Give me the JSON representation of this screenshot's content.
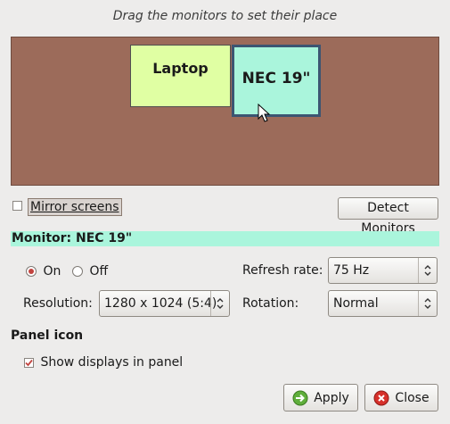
{
  "hint": "Drag the monitors to set their place",
  "monitors": [
    {
      "name": "Laptop"
    },
    {
      "name": "NEC 19\""
    }
  ],
  "mirror": {
    "label": "Mirror screens",
    "checked": false
  },
  "detect_button": "Detect Monitors",
  "monitor_bar": "Monitor: NEC 19\"",
  "power": {
    "on_label": "On",
    "off_label": "Off",
    "selected": "On"
  },
  "resolution": {
    "label": "Resolution:",
    "value": "1280 x 1024 (5:4)"
  },
  "refresh": {
    "label": "Refresh rate:",
    "value": "75 Hz"
  },
  "rotation": {
    "label": "Rotation:",
    "value": "Normal"
  },
  "panel": {
    "heading": "Panel icon",
    "show_label": "Show displays in panel",
    "show_checked": true
  },
  "buttons": {
    "apply": "Apply",
    "close": "Close"
  },
  "colors": {
    "canvas": "#9c6b5a",
    "laptop": "#e0ffa3",
    "nec": "#aaf5dc",
    "selected_border": "#3c5572"
  }
}
